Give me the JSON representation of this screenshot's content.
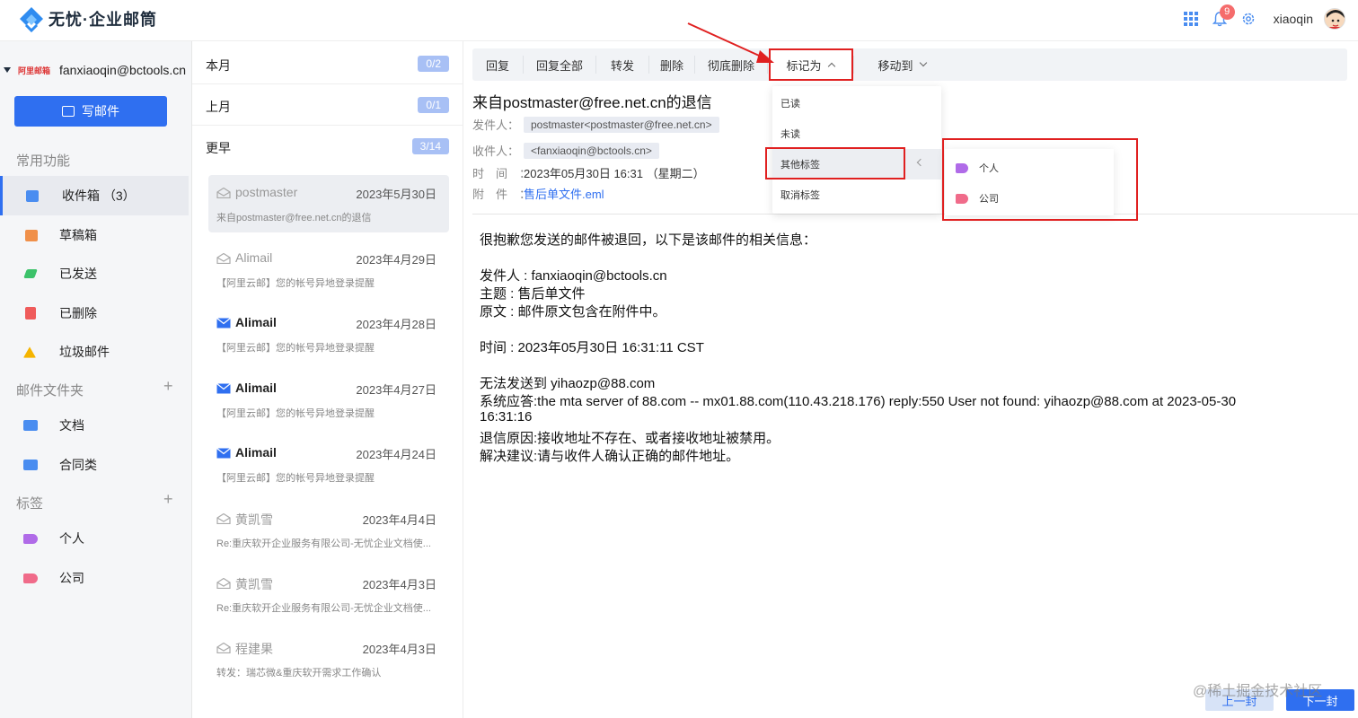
{
  "app": {
    "logo_text": "无忧·企业邮筒",
    "brand_color": "#2f6ff0"
  },
  "topbar": {
    "notification_count": "9",
    "username": "xiaoqin"
  },
  "sidebar": {
    "account": {
      "provider_logo_text": "阿里邮箱",
      "address": "fanxiaoqin@bctools.cn"
    },
    "compose_label": "写邮件",
    "sections": {
      "common": "常用功能",
      "folders": "邮件文件夹",
      "tags": "标签"
    },
    "nav": [
      {
        "label": "收件箱 （3）",
        "icon": "inbox-icon",
        "color": "#4a8df0"
      },
      {
        "label": "草稿箱",
        "icon": "draft-icon",
        "color": "#f0904a"
      },
      {
        "label": "已发送",
        "icon": "sent-icon",
        "color": "#3cc26a"
      },
      {
        "label": "已删除",
        "icon": "trash-icon",
        "color": "#ef5b5b"
      },
      {
        "label": "垃圾邮件",
        "icon": "spam-icon",
        "color": "#f5b400"
      }
    ],
    "folders": [
      {
        "label": "文档",
        "icon": "folder-icon",
        "color": "#4a8df0"
      },
      {
        "label": "合同类",
        "icon": "folder-icon",
        "color": "#4a8df0"
      }
    ],
    "tags": [
      {
        "label": "个人",
        "icon": "tag-icon",
        "color": "#b06be8"
      },
      {
        "label": "公司",
        "icon": "tag-icon",
        "color": "#f06b8a"
      }
    ]
  },
  "mail_list": {
    "groups": [
      {
        "label": "本月",
        "count": "0/2"
      },
      {
        "label": "上月",
        "count": "0/1"
      },
      {
        "label": "更早",
        "count": "3/14"
      }
    ],
    "items": [
      {
        "sender": "postmaster",
        "date": "2023年5月30日",
        "subject": "来自postmaster@free.net.cn的退信",
        "read": true,
        "selected": true
      },
      {
        "sender": "Alimail",
        "date": "2023年4月29日",
        "subject": "【阿里云邮】您的帐号异地登录提醒",
        "read": true,
        "selected": false
      },
      {
        "sender": "Alimail",
        "date": "2023年4月28日",
        "subject": "【阿里云邮】您的帐号异地登录提醒",
        "read": false,
        "selected": false
      },
      {
        "sender": "Alimail",
        "date": "2023年4月27日",
        "subject": "【阿里云邮】您的帐号异地登录提醒",
        "read": false,
        "selected": false
      },
      {
        "sender": "Alimail",
        "date": "2023年4月24日",
        "subject": "【阿里云邮】您的帐号异地登录提醒",
        "read": false,
        "selected": false
      },
      {
        "sender": "黄凯雪",
        "date": "2023年4月4日",
        "subject": "Re:重庆软开企业服务有限公司-无忧企业文档使...",
        "read": true,
        "selected": false
      },
      {
        "sender": "黄凯雪",
        "date": "2023年4月3日",
        "subject": "Re:重庆软开企业服务有限公司-无忧企业文档使...",
        "read": true,
        "selected": false
      },
      {
        "sender": "程建果",
        "date": "2023年4月3日",
        "subject": "转发：瑞芯微&重庆软开需求工作确认",
        "read": true,
        "selected": false
      }
    ]
  },
  "toolbar": {
    "reply": "回复",
    "reply_all": "回复全部",
    "forward": "转发",
    "delete": "删除",
    "delete_forever": "彻底删除",
    "mark_as": "标记为",
    "move_to": "移动到"
  },
  "mark_menu": {
    "items": [
      "已读",
      "未读",
      "其他标签",
      "取消标签"
    ],
    "submenu": [
      {
        "label": "个人",
        "color": "#b06be8"
      },
      {
        "label": "公司",
        "color": "#f06b8a"
      }
    ]
  },
  "message": {
    "title": "来自postmaster@free.net.cn的退信",
    "from_label": "发件人：",
    "from": "postmaster<postmaster@free.net.cn>",
    "to_label": "收件人：",
    "to": "<fanxiaoqin@bctools.cn>",
    "time_label": "时　间　：",
    "time": "2023年05月30日 16:31 （星期二）",
    "attach_label": "附　件　：",
    "attachment": "售后单文件.eml",
    "body": [
      "很抱歉您发送的邮件被退回，以下是该邮件的相关信息：",
      "",
      "发件人 : fanxiaoqin@bctools.cn",
      "主题 : 售后单文件",
      "原文 : 邮件原文包含在附件中。",
      "",
      "时间 : 2023年05月30日 16:31:11 CST",
      "",
      "无法发送到 yihaozp@88.com",
      "系统应答:the mta server of 88.com -- mx01.88.com(110.43.218.176) reply:550 User not found: yihaozp@88.com at 2023-05-30",
      "16:31:16",
      "退信原因:接收地址不存在、或者接收地址被禁用。",
      "解决建议:请与收件人确认正确的邮件地址。"
    ]
  },
  "pager": {
    "prev": "上一封",
    "next": "下一封"
  },
  "watermark": "@稀土掘金技术社区"
}
